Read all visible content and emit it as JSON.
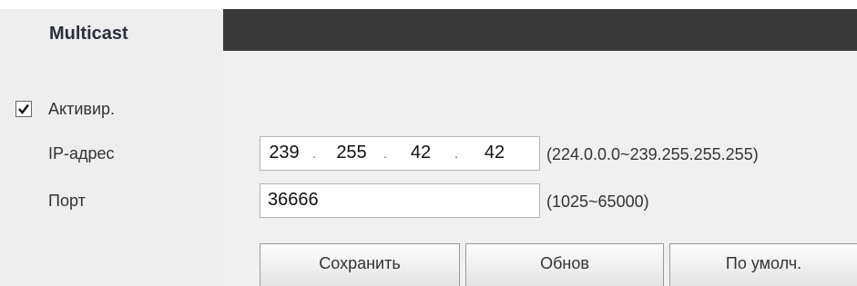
{
  "doc_crop_text": "",
  "tab": {
    "label": "Multicast"
  },
  "enable": {
    "label": "Активир.",
    "checked": true
  },
  "ip": {
    "label": "IP-адрес",
    "octets": [
      "239",
      "255",
      "42",
      "42"
    ],
    "range": "(224.0.0.0~239.255.255.255)"
  },
  "port": {
    "label": "Порт",
    "value": "36666",
    "range": "(1025~65000)"
  },
  "buttons": {
    "save": "Сохранить",
    "refresh": "Обнов",
    "default": "По умолч."
  },
  "colors": {
    "header_bar": "#393939",
    "panel": "#eeeeee"
  }
}
